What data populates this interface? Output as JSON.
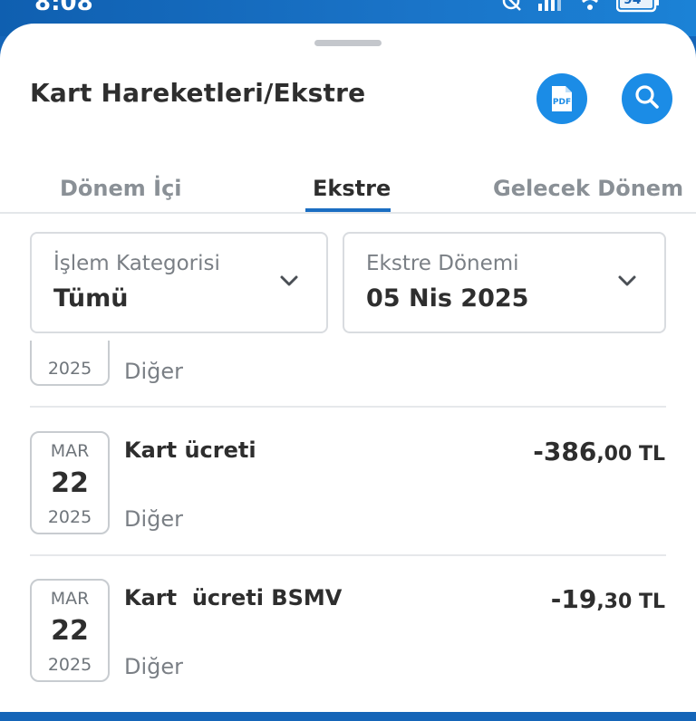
{
  "status": {
    "time": "8:08",
    "battery": "94"
  },
  "header": {
    "title": "Kart Hareketleri/Ekstre",
    "pdf_label": "PDF"
  },
  "tabs": [
    {
      "label": "Dönem İçi"
    },
    {
      "label": "Ekstre"
    },
    {
      "label": "Gelecek Dönem"
    }
  ],
  "filters": {
    "category": {
      "label": "İşlem Kategorisi",
      "value": "Tümü"
    },
    "period": {
      "label": "Ekstre Dönemi",
      "value": "05 Nis 2025"
    }
  },
  "transactions": [
    {
      "month": "",
      "day": "",
      "year": "2025",
      "title": "",
      "category": "Diğer",
      "amount_int": "",
      "amount_dec": ""
    },
    {
      "month": "MAR",
      "day": "22",
      "year": "2025",
      "title": "Kart ücreti",
      "category": "Diğer",
      "amount_int": "-386",
      "amount_dec": ",00 TL"
    },
    {
      "month": "MAR",
      "day": "22",
      "year": "2025",
      "title": "Kart  ücreti BSMV",
      "category": "Diğer",
      "amount_int": "-19",
      "amount_dec": ",30 TL"
    }
  ],
  "colors": {
    "accent": "#1b8ce6",
    "tab_indicator": "#1b6ec2"
  }
}
